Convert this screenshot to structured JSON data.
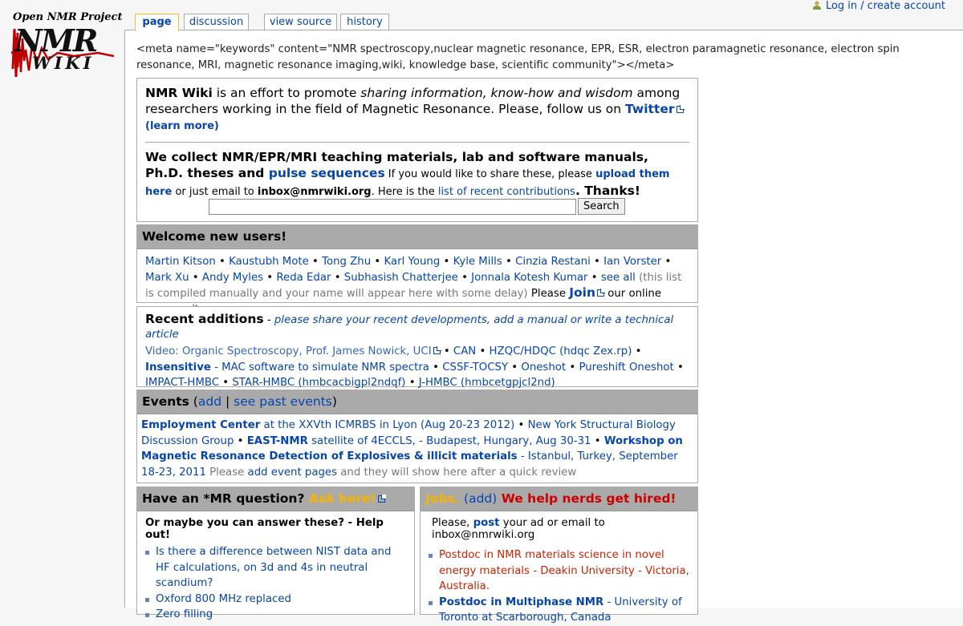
{
  "logo": {
    "project": "Open NMR Project",
    "main": "NMR",
    "sub": "WIKI"
  },
  "personal": {
    "login_label": "Log in / create account"
  },
  "tabs": [
    {
      "label": "page"
    },
    {
      "label": "discussion"
    },
    {
      "label": "view source"
    },
    {
      "label": "history"
    }
  ],
  "meta_text": "<meta name=\"keywords\" content=\"NMR spectroscopy,nuclear magnetic resonance, EPR, ESR, electron paramagnetic resonance, electron spin resonance, MRI, magnetic resonance imaging,wiki, knowledge base, scientific community\"></meta>",
  "intro": {
    "site": "NMR Wiki",
    "t1": " is an effort to promote ",
    "t1_em": "sharing information, know-how and wisdom",
    "t2": " among researchers working in the field of Magnetic Resonance. Please, follow us on ",
    "twitter": "Twitter",
    "learn_more": "(learn more)",
    "collect": "We collect NMR/EPR/MRI teaching materials, lab and software manuals, Ph.D. theses and ",
    "pulse": "pulse sequences",
    "share": " If you would like to share these, please ",
    "upload": "upload them here",
    "email_text": " or just email to ",
    "email": "inbox@nmrwiki.org",
    "here_is": ". Here is the ",
    "contrib": "list of recent contributions",
    "thanks": ". Thanks!",
    "search_button": "Search",
    "search_value": ""
  },
  "welcome": {
    "title": "Welcome new users!",
    "users": [
      "Martin Kitson",
      "Kaustubh Mote",
      "Tong Zhu",
      "Karl Young",
      "Kyle Mills",
      "Cinzia Restani",
      "Ian Vorster",
      "Mark Xu",
      "Andy Myles",
      "Reda Edar",
      "Subhasish Chatterjee",
      "Jonnala Kotesh Kumar"
    ],
    "see_all": "see all",
    "note": " (this list is compiled manually and your name will appear here with some delay)",
    "please": " Please ",
    "join": "Join",
    "community": " our online community."
  },
  "recent": {
    "title": "Recent additions",
    "dash": " - ",
    "subtitle": "please share your recent developments, add a manual or write a technical article",
    "video": "Video: Organic Spectroscopy, Prof. James Nowick, UCI",
    "can": "CAN",
    "hzqc": "HZQC/HDQC (hdqc Zex.rp)",
    "insensitive": "Insensitive",
    "mac": " - MAC software to simulate NMR spectra",
    "csst": "CSSF-TOCSY",
    "oneshot": "Oneshot",
    "pureshift": "Pureshift Oneshot",
    "impact": "IMPACT-HMBC",
    "star": "STAR-HMBC (hmbcacbigpl2ndqf)",
    "jhmbc": "J-HMBC (hmbcetgpjcl2nd)"
  },
  "events": {
    "title": "Events",
    "add": "add",
    "sep": "|",
    "past": "see past events",
    "e1_bold": "Employment Center",
    "e1_rest": " at the XXVth ICMRBS in Lyon (Aug 20-23 2012)",
    "e2": "New York Structural Biology Discussion Group",
    "e3_bold": "EAST-NMR",
    "e3_rest": " satellite of 4ECCLS, - Budapest, Hungary, Aug 30-31",
    "e4_bold": "Workshop on Magnetic Resonance Detection of Explosives & illicit materials",
    "e4_rest": " - Istanbul, Turkey, September 18-23, 2011",
    "please": " Please ",
    "add_pages": "add event pages",
    "after": " and they will show here after a quick review"
  },
  "qa": {
    "title": "Have an *MR question? ",
    "ask": "Ask here!",
    "subtitle": "Or maybe you can answer these? - Help out!",
    "items": [
      "Is there a difference between NIST data and HF calculations, on 3d and 4s in neutral scandium?",
      "Oxford 800 MHz replaced",
      "Zero filling"
    ]
  },
  "jobs": {
    "jobs_label": "Jobs.",
    "add": "(add)",
    "help": " We help nerds get hired!",
    "please": "Please, ",
    "post": "post",
    "rest": " your ad or email to inbox@nmrwiki.org",
    "items": [
      {
        "text": "Postdoc in NMR materials science in novel energy materials - Deakin University - Victoria, Australia.",
        "bold": "",
        "rest": ""
      },
      {
        "text": "",
        "bold": "Postdoc in Multiphase NMR",
        "rest": " - University of Toronto at Scarborough, Canada"
      }
    ]
  },
  "colors": {
    "tab_selected_border": "#fabd23",
    "box_header": "#aaaaaa",
    "link": "#0645ad",
    "ask": "#f4b400",
    "jobs_red": "#cc0000"
  }
}
